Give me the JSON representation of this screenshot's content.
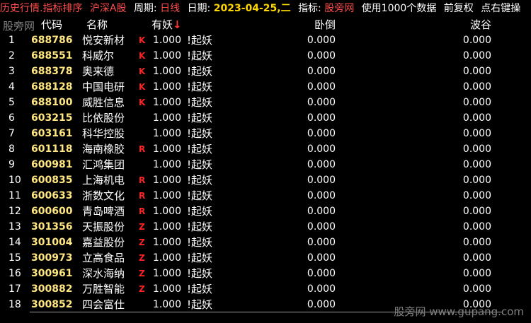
{
  "topbar": {
    "title": "历史行情.指标排序",
    "market": "沪深A股",
    "period_label": "周期:",
    "period_value": "日线",
    "date_label": "日期:",
    "date_value": "2023-04-25,二",
    "indicator_label": "指标:",
    "indicator_value": "股旁网",
    "data_use": "使用1000个数据",
    "adjust": "前复权",
    "tip": "点右键操"
  },
  "watermarks": {
    "top": "股旁网",
    "bottom": "股旁网 www.gupang.com"
  },
  "header": {
    "code": "代码",
    "name": "名称",
    "col1": "有妖",
    "sort_arrow": "↓",
    "col2": "卧倒",
    "col3": "波谷"
  },
  "rows": [
    {
      "idx": "1",
      "code": "688786",
      "name": "悦安新材",
      "flag": "K",
      "v1": "1.000",
      "tag": "!起妖",
      "v2": "0.000",
      "v3": "0.000"
    },
    {
      "idx": "2",
      "code": "688551",
      "name": "科威尔",
      "flag": "K",
      "v1": "1.000",
      "tag": "!起妖",
      "v2": "0.000",
      "v3": "0.000"
    },
    {
      "idx": "3",
      "code": "688378",
      "name": "奥来德",
      "flag": "K",
      "v1": "1.000",
      "tag": "!起妖",
      "v2": "0.000",
      "v3": "0.000"
    },
    {
      "idx": "4",
      "code": "688128",
      "name": "中国电研",
      "flag": "K",
      "v1": "1.000",
      "tag": "!起妖",
      "v2": "0.000",
      "v3": "0.000"
    },
    {
      "idx": "5",
      "code": "688100",
      "name": "威胜信息",
      "flag": "K",
      "v1": "1.000",
      "tag": "!起妖",
      "v2": "0.000",
      "v3": "0.000"
    },
    {
      "idx": "6",
      "code": "603215",
      "name": "比依股份",
      "flag": "",
      "v1": "1.000",
      "tag": "!起妖",
      "v2": "0.000",
      "v3": "0.000"
    },
    {
      "idx": "7",
      "code": "603161",
      "name": "科华控股",
      "flag": "",
      "v1": "1.000",
      "tag": "!起妖",
      "v2": "0.000",
      "v3": "0.000"
    },
    {
      "idx": "8",
      "code": "601118",
      "name": "海南橡胶",
      "flag": "R",
      "v1": "1.000",
      "tag": "!起妖",
      "v2": "0.000",
      "v3": "0.000"
    },
    {
      "idx": "9",
      "code": "600981",
      "name": "汇鸿集团",
      "flag": "",
      "v1": "1.000",
      "tag": "!起妖",
      "v2": "0.000",
      "v3": "0.000"
    },
    {
      "idx": "10",
      "code": "600835",
      "name": "上海机电",
      "flag": "R",
      "v1": "1.000",
      "tag": "!起妖",
      "v2": "0.000",
      "v3": "0.000"
    },
    {
      "idx": "11",
      "code": "600633",
      "name": "浙数文化",
      "flag": "R",
      "v1": "1.000",
      "tag": "!起妖",
      "v2": "0.000",
      "v3": "0.000"
    },
    {
      "idx": "12",
      "code": "600600",
      "name": "青岛啤酒",
      "flag": "R",
      "v1": "1.000",
      "tag": "!起妖",
      "v2": "0.000",
      "v3": "0.000"
    },
    {
      "idx": "13",
      "code": "301356",
      "name": "天振股份",
      "flag": "Z",
      "v1": "1.000",
      "tag": "!起妖",
      "v2": "0.000",
      "v3": "0.000"
    },
    {
      "idx": "14",
      "code": "301004",
      "name": "嘉益股份",
      "flag": "Z",
      "v1": "1.000",
      "tag": "!起妖",
      "v2": "0.000",
      "v3": "0.000"
    },
    {
      "idx": "15",
      "code": "300973",
      "name": "立高食品",
      "flag": "Z",
      "v1": "1.000",
      "tag": "!起妖",
      "v2": "0.000",
      "v3": "0.000"
    },
    {
      "idx": "16",
      "code": "300961",
      "name": "深水海纳",
      "flag": "Z",
      "v1": "1.000",
      "tag": "!起妖",
      "v2": "0.000",
      "v3": "0.000"
    },
    {
      "idx": "17",
      "code": "300882",
      "name": "万胜智能",
      "flag": "Z",
      "v1": "1.000",
      "tag": "!起妖",
      "v2": "0.000",
      "v3": "0.000"
    },
    {
      "idx": "18",
      "code": "300852",
      "name": "四会富仕",
      "flag": "",
      "v1": "1.000",
      "tag": "!起妖",
      "v2": "0.000",
      "v3": "0.000"
    }
  ],
  "colors": {
    "background": "#000000",
    "title_red": "#ff4d4d",
    "code_yellow": "#ffe680",
    "date_yellow": "#ffd700",
    "flag_red": "#ff2222"
  }
}
